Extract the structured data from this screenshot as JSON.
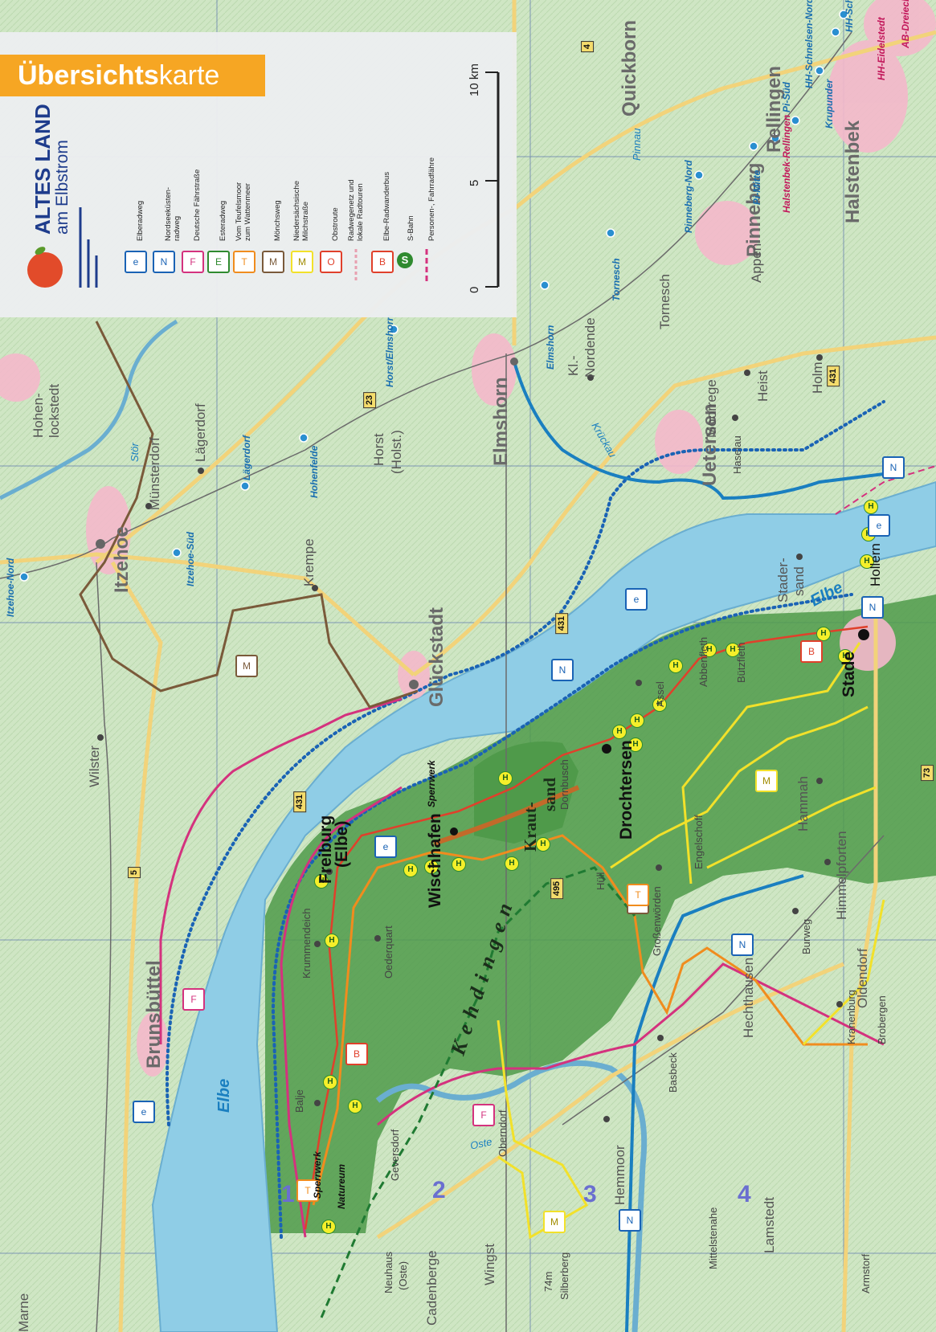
{
  "header": {
    "title_part1": "Übersichts",
    "title_part2": "karte"
  },
  "brand": {
    "line1": "ALTES LAND",
    "line2": "am Elbstrom"
  },
  "legend": {
    "items": [
      {
        "label": "Elberadweg",
        "icon": "elberadweg-icon",
        "color": "#1a63b5"
      },
      {
        "label": "Nordseeküsten-radweg",
        "icon": "nordseekuestenradweg-icon",
        "color": "#1a63b5"
      },
      {
        "label": "Deutsche Fährstraße",
        "icon": "faehrstrasse-icon",
        "color": "#d4327e"
      },
      {
        "label": "Esteradweg",
        "icon": "esteradweg-icon",
        "color": "#2f8a2f"
      },
      {
        "label": "Vom Teufelsmoor zum Wattenmeer",
        "icon": "teufelsmoor-icon",
        "color": "#f08c1e"
      },
      {
        "label": "Mönchsweg",
        "icon": "moenchsweg-icon",
        "color": "#7a5a3a"
      },
      {
        "label": "Niedersächsische Milchstraße",
        "icon": "milchstrasse-icon",
        "color": "#f2e12a"
      },
      {
        "label": "Obstroute",
        "icon": "obstroute-icon",
        "color": "#e0402b"
      },
      {
        "label": "Radwegenetz und lokale Radtouren",
        "icon": "radwegenetz-icon",
        "color": "#e8a0b0"
      },
      {
        "label": "Elbe-Radwanderbus",
        "icon": "radwanderbus-icon",
        "color": "#e0402b"
      },
      {
        "label": "S-Bahn",
        "icon": "s-bahn-icon",
        "color": "#2f8a2f"
      },
      {
        "label": "Personen-, Fahrradfähre",
        "icon": "faehre-icon",
        "color": "#d4327e"
      }
    ],
    "scale": {
      "ticks": [
        "0",
        "5",
        "10 km"
      ]
    }
  },
  "map": {
    "rivers": {
      "elbe": "Elbe",
      "oste": "Oste",
      "stoer": "Stör",
      "krueckau": "Krückau",
      "pinnau": "Pinnau"
    },
    "region": "Kehdingen",
    "island": {
      "line1": "Kraut-",
      "line2": "sand"
    },
    "towns_large": [
      "Itzehoe",
      "Glückstadt",
      "Elmshorn",
      "Uetersen",
      "Pinneberg",
      "Rellingen",
      "Halstenbek",
      "Quickborn",
      "Brunsbüttel"
    ],
    "towns_medium": [
      "Hohen-",
      "lockstedt",
      "Lägerdorf",
      "Münsterdorf",
      "Krempe",
      "Horst",
      "(Holst.)",
      "Wilster",
      "Tornesch",
      "Appen",
      "Heist",
      "Holm",
      "Moorrege",
      "Haselau",
      "Kl.-",
      "Nordende",
      "Marne",
      "Balje",
      "Oederquart",
      "Krummendeich",
      "Dornbusch",
      "Assel",
      "Abbenfleth",
      "Bützfleth",
      "Stader-",
      "sand",
      "Hammah",
      "Engelschoff",
      "Himmelpforten",
      "Großenwörden",
      "Hüll",
      "Burweg",
      "Oldendorf",
      "Hechthausen",
      "Kranenburg",
      "Brobergen",
      "Basbeck",
      "Hemmoor",
      "Oberndorf",
      "Geversdorf",
      "Lamstedt",
      "Mittelstenahe",
      "Armstorf",
      "Wingst",
      "Cadenberge",
      "Neuhaus",
      "(Oste)",
      "Hollern"
    ],
    "towns_bold": [
      "Freiburg",
      "(Elbe)",
      "Wischhafen",
      "Drochtersen",
      "Stade"
    ],
    "stations": [
      "Itzehoe-Nord",
      "Itzehoe-Süd",
      "Lägerdorf",
      "Hohenfelde",
      "Horst/Elmshorn",
      "Elmshorn",
      "Tornesch",
      "Pinneberg-Nord",
      "Pi-Mitte",
      "Pi-Süd",
      "Halstenbek-Rellingen",
      "HH-Schnelsen-Nord",
      "HH-Schnelsen",
      "HH-Eidelstedt",
      "AB-Dreieck HH-Nordwest",
      "Krupunder"
    ],
    "poi": {
      "sperrwerk": "Sperrwerk",
      "natureum": "Natureum",
      "wingst_hill": "74m",
      "silberberg": "Silberberg"
    },
    "road_numbers": [
      "4",
      "23",
      "431",
      "431",
      "5",
      "431",
      "495",
      "73"
    ],
    "section_numbers": [
      "1",
      "2",
      "3",
      "4"
    ],
    "bus_stop_letter": "H"
  }
}
